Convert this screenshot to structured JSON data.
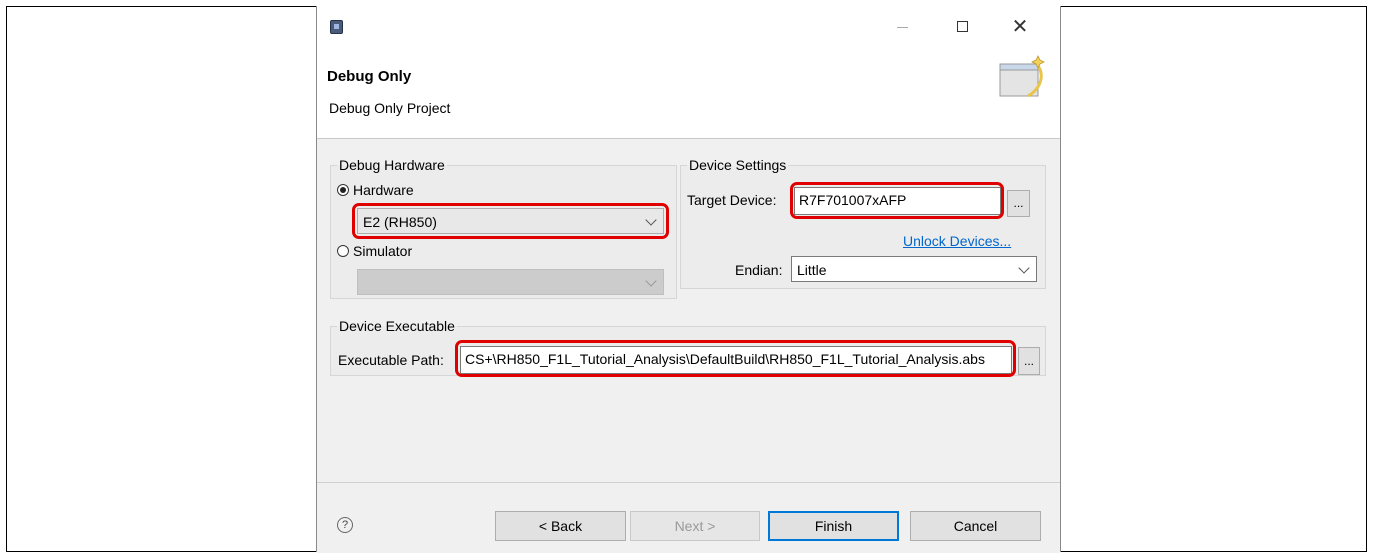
{
  "wizard": {
    "title": "Debug Only",
    "subtitle": "Debug Only Project"
  },
  "window_controls": {
    "close_glyph": "✕"
  },
  "debug_hardware": {
    "group_label": "Debug Hardware",
    "hardware_radio_label": "Hardware",
    "hardware_selected": true,
    "hardware_value": "E2 (RH850)",
    "simulator_radio_label": "Simulator",
    "simulator_value": ""
  },
  "device_settings": {
    "group_label": "Device Settings",
    "target_device_label": "Target Device:",
    "target_device_value": "R7F701007xAFP",
    "browse_label": "...",
    "unlock_link": "Unlock Devices...",
    "endian_label": "Endian:",
    "endian_value": "Little"
  },
  "device_executable": {
    "group_label": "Device Executable",
    "path_label": "Executable Path:",
    "path_value": "CS+\\RH850_F1L_Tutorial_Analysis\\DefaultBuild\\RH850_F1L_Tutorial_Analysis.abs",
    "browse_label": "..."
  },
  "footer": {
    "help_glyph": "?",
    "back_label": "< Back",
    "next_label": "Next >",
    "finish_label": "Finish",
    "cancel_label": "Cancel"
  },
  "colors": {
    "highlight": "#e00000",
    "link": "#0066cc",
    "default_button_border": "#0078d7"
  },
  "icons": [
    "app-icon",
    "minimize-icon",
    "maximize-icon",
    "close-icon",
    "wizard-banner-icon",
    "chevron-down-icon",
    "help-icon"
  ]
}
